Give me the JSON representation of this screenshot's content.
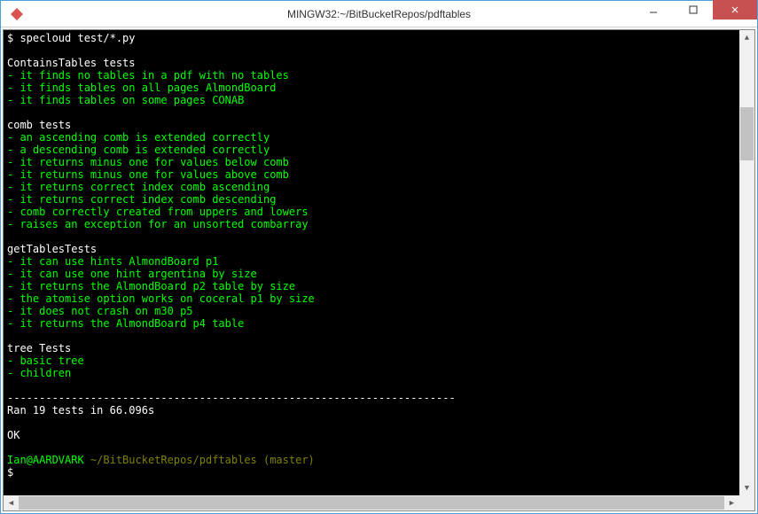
{
  "window": {
    "title": "MINGW32:~/BitBucketRepos/pdftables"
  },
  "prompt": {
    "symbol": "$",
    "command": "specloud test/*.py"
  },
  "sections": [
    {
      "header": "ContainsTables tests",
      "items": [
        "it finds no tables in a pdf with no tables",
        "it finds tables on all pages AlmondBoard",
        "it finds tables on some pages CONAB"
      ]
    },
    {
      "header": "comb tests",
      "items": [
        "an ascending comb is extended correctly",
        "a descending comb is extended correctly",
        "it returns minus one for values below comb",
        "it returns minus one for values above comb",
        "it returns correct index comb ascending",
        "it returns correct index comb descending",
        "comb correctly created from uppers and lowers",
        "raises an exception for an unsorted combarray"
      ]
    },
    {
      "header": "getTablesTests",
      "items": [
        "it can use hints AlmondBoard p1",
        "it can use one hint argentina by size",
        "it returns the AlmondBoard p2 table by size",
        "the atomise option works on coceral p1 by size",
        "it does not crash on m30 p5",
        "it returns the AlmondBoard p4 table"
      ]
    },
    {
      "header": "tree Tests",
      "items": [
        "basic tree",
        "children"
      ]
    }
  ],
  "separator": "----------------------------------------------------------------------",
  "summary": "Ran 19 tests in 66.096s",
  "status": "OK",
  "shell_prompt": {
    "user_host": "Ian@AARDVARK",
    "path": "~/BitBucketRepos/pdftables",
    "branch": "(master)",
    "symbol": "$"
  }
}
